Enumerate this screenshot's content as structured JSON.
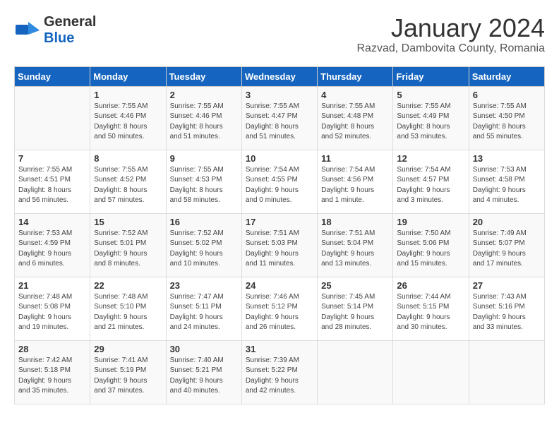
{
  "logo": {
    "part1": "General",
    "part2": "Blue"
  },
  "title": "January 2024",
  "location": "Razvad, Dambovita County, Romania",
  "days_header": [
    "Sunday",
    "Monday",
    "Tuesday",
    "Wednesday",
    "Thursday",
    "Friday",
    "Saturday"
  ],
  "weeks": [
    [
      {
        "day": "",
        "info": ""
      },
      {
        "day": "1",
        "info": "Sunrise: 7:55 AM\nSunset: 4:46 PM\nDaylight: 8 hours\nand 50 minutes."
      },
      {
        "day": "2",
        "info": "Sunrise: 7:55 AM\nSunset: 4:46 PM\nDaylight: 8 hours\nand 51 minutes."
      },
      {
        "day": "3",
        "info": "Sunrise: 7:55 AM\nSunset: 4:47 PM\nDaylight: 8 hours\nand 51 minutes."
      },
      {
        "day": "4",
        "info": "Sunrise: 7:55 AM\nSunset: 4:48 PM\nDaylight: 8 hours\nand 52 minutes."
      },
      {
        "day": "5",
        "info": "Sunrise: 7:55 AM\nSunset: 4:49 PM\nDaylight: 8 hours\nand 53 minutes."
      },
      {
        "day": "6",
        "info": "Sunrise: 7:55 AM\nSunset: 4:50 PM\nDaylight: 8 hours\nand 55 minutes."
      }
    ],
    [
      {
        "day": "7",
        "info": "Sunrise: 7:55 AM\nSunset: 4:51 PM\nDaylight: 8 hours\nand 56 minutes."
      },
      {
        "day": "8",
        "info": "Sunrise: 7:55 AM\nSunset: 4:52 PM\nDaylight: 8 hours\nand 57 minutes."
      },
      {
        "day": "9",
        "info": "Sunrise: 7:55 AM\nSunset: 4:53 PM\nDaylight: 8 hours\nand 58 minutes."
      },
      {
        "day": "10",
        "info": "Sunrise: 7:54 AM\nSunset: 4:55 PM\nDaylight: 9 hours\nand 0 minutes."
      },
      {
        "day": "11",
        "info": "Sunrise: 7:54 AM\nSunset: 4:56 PM\nDaylight: 9 hours\nand 1 minute."
      },
      {
        "day": "12",
        "info": "Sunrise: 7:54 AM\nSunset: 4:57 PM\nDaylight: 9 hours\nand 3 minutes."
      },
      {
        "day": "13",
        "info": "Sunrise: 7:53 AM\nSunset: 4:58 PM\nDaylight: 9 hours\nand 4 minutes."
      }
    ],
    [
      {
        "day": "14",
        "info": "Sunrise: 7:53 AM\nSunset: 4:59 PM\nDaylight: 9 hours\nand 6 minutes."
      },
      {
        "day": "15",
        "info": "Sunrise: 7:52 AM\nSunset: 5:01 PM\nDaylight: 9 hours\nand 8 minutes."
      },
      {
        "day": "16",
        "info": "Sunrise: 7:52 AM\nSunset: 5:02 PM\nDaylight: 9 hours\nand 10 minutes."
      },
      {
        "day": "17",
        "info": "Sunrise: 7:51 AM\nSunset: 5:03 PM\nDaylight: 9 hours\nand 11 minutes."
      },
      {
        "day": "18",
        "info": "Sunrise: 7:51 AM\nSunset: 5:04 PM\nDaylight: 9 hours\nand 13 minutes."
      },
      {
        "day": "19",
        "info": "Sunrise: 7:50 AM\nSunset: 5:06 PM\nDaylight: 9 hours\nand 15 minutes."
      },
      {
        "day": "20",
        "info": "Sunrise: 7:49 AM\nSunset: 5:07 PM\nDaylight: 9 hours\nand 17 minutes."
      }
    ],
    [
      {
        "day": "21",
        "info": "Sunrise: 7:48 AM\nSunset: 5:08 PM\nDaylight: 9 hours\nand 19 minutes."
      },
      {
        "day": "22",
        "info": "Sunrise: 7:48 AM\nSunset: 5:10 PM\nDaylight: 9 hours\nand 21 minutes."
      },
      {
        "day": "23",
        "info": "Sunrise: 7:47 AM\nSunset: 5:11 PM\nDaylight: 9 hours\nand 24 minutes."
      },
      {
        "day": "24",
        "info": "Sunrise: 7:46 AM\nSunset: 5:12 PM\nDaylight: 9 hours\nand 26 minutes."
      },
      {
        "day": "25",
        "info": "Sunrise: 7:45 AM\nSunset: 5:14 PM\nDaylight: 9 hours\nand 28 minutes."
      },
      {
        "day": "26",
        "info": "Sunrise: 7:44 AM\nSunset: 5:15 PM\nDaylight: 9 hours\nand 30 minutes."
      },
      {
        "day": "27",
        "info": "Sunrise: 7:43 AM\nSunset: 5:16 PM\nDaylight: 9 hours\nand 33 minutes."
      }
    ],
    [
      {
        "day": "28",
        "info": "Sunrise: 7:42 AM\nSunset: 5:18 PM\nDaylight: 9 hours\nand 35 minutes."
      },
      {
        "day": "29",
        "info": "Sunrise: 7:41 AM\nSunset: 5:19 PM\nDaylight: 9 hours\nand 37 minutes."
      },
      {
        "day": "30",
        "info": "Sunrise: 7:40 AM\nSunset: 5:21 PM\nDaylight: 9 hours\nand 40 minutes."
      },
      {
        "day": "31",
        "info": "Sunrise: 7:39 AM\nSunset: 5:22 PM\nDaylight: 9 hours\nand 42 minutes."
      },
      {
        "day": "",
        "info": ""
      },
      {
        "day": "",
        "info": ""
      },
      {
        "day": "",
        "info": ""
      }
    ]
  ]
}
